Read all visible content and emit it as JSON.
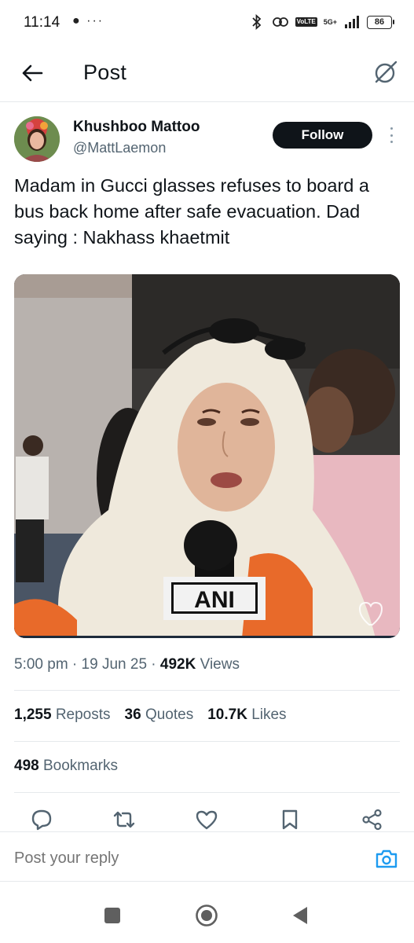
{
  "status_bar": {
    "time": "11:14",
    "left_icons": "● ···",
    "volte": "VoLTE",
    "network": "5G+",
    "battery": "86"
  },
  "header": {
    "title": "Post",
    "back_icon": "arrow-left-icon",
    "grok_icon": "grok-icon"
  },
  "post": {
    "author_name": "Khushboo Mattoo",
    "author_handle": "@MattLaemon",
    "follow_label": "Follow",
    "text": "Madam in Gucci glasses refuses to board a bus back home after safe evacuation. Dad saying : Nakhass khaetmit",
    "media_mic_label": "ANI"
  },
  "meta": {
    "time": "5:00 pm",
    "date": "19 Jun 25",
    "views_count": "492K",
    "views_label": "Views"
  },
  "stats": {
    "reposts_count": "1,255",
    "reposts_label": "Reposts",
    "quotes_count": "36",
    "quotes_label": "Quotes",
    "likes_count": "10.7K",
    "likes_label": "Likes",
    "bookmarks_count": "498",
    "bookmarks_label": "Bookmarks"
  },
  "actions": [
    "reply-icon",
    "repost-icon",
    "like-icon",
    "bookmark-icon",
    "share-icon"
  ],
  "reply": {
    "placeholder": "Post your reply"
  },
  "colors": {
    "accent": "#1d9bf0",
    "text": "#0f1419",
    "secondary": "#536471",
    "follow_bg": "#0f1419"
  }
}
